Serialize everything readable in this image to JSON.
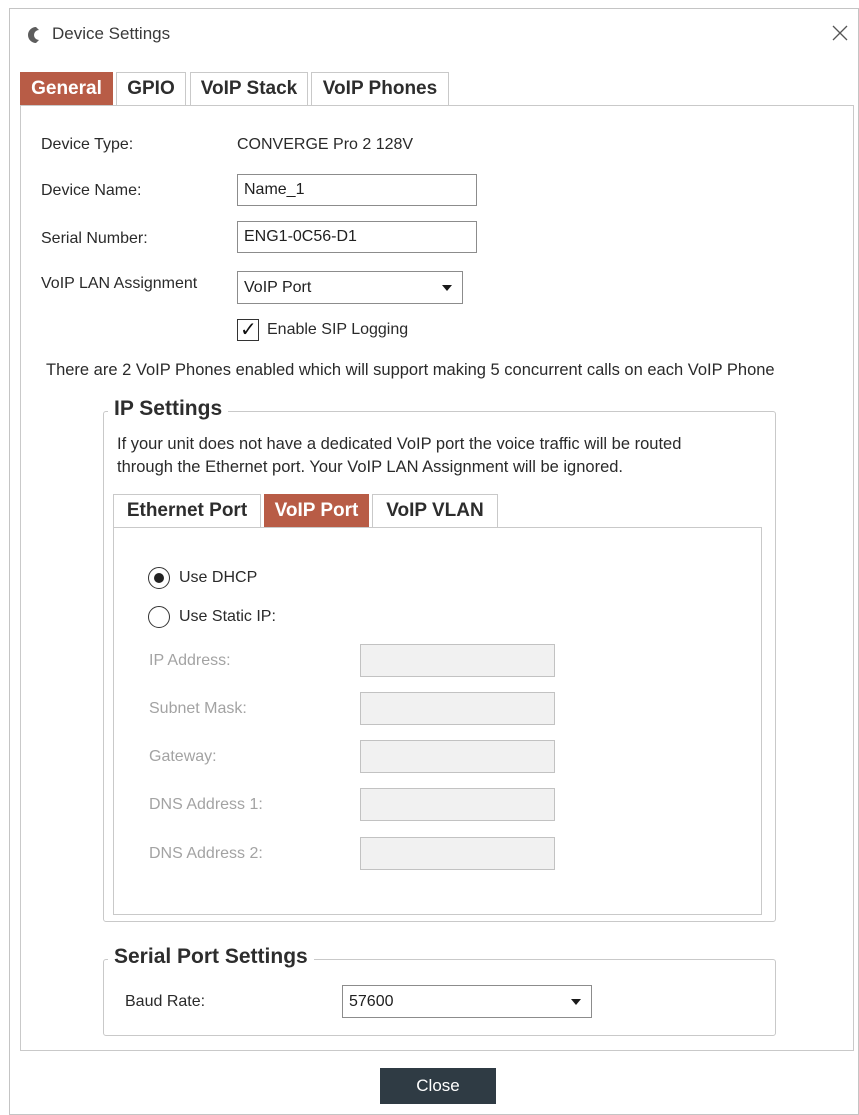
{
  "window": {
    "title": "Device Settings"
  },
  "tabs": [
    "General",
    "GPIO",
    "VoIP Stack",
    "VoIP Phones"
  ],
  "general": {
    "device_type_label": "Device Type:",
    "device_type_value": "CONVERGE Pro 2 128V",
    "device_name_label": "Device Name:",
    "device_name_value": "Name_1",
    "serial_label": "Serial Number:",
    "serial_value": "ENG1-0C56-D1",
    "voip_lan_label": "VoIP LAN Assignment",
    "voip_lan_value": "VoIP Port",
    "sip_logging_label": "Enable SIP Logging",
    "sip_logging_checked": true,
    "info_text": "There are 2 VoIP Phones enabled which will support making 5 concurrent calls on each VoIP Phone"
  },
  "ip_settings": {
    "title": "IP Settings",
    "description_line1": "If your unit does not have a dedicated VoIP port the voice traffic will be routed",
    "description_line2": "through the Ethernet port.  Your VoIP LAN Assignment will be ignored.",
    "tabs": [
      "Ethernet Port",
      "VoIP Port",
      "VoIP VLAN"
    ],
    "dhcp_label": "Use DHCP",
    "static_label": "Use Static IP:",
    "mode": "dhcp",
    "ip_label": "IP Address:",
    "subnet_label": "Subnet Mask:",
    "gateway_label": "Gateway:",
    "dns1_label": "DNS Address 1:",
    "dns2_label": "DNS Address 2:"
  },
  "serial_port": {
    "title": "Serial Port Settings",
    "baud_label": "Baud Rate:",
    "baud_value": "57600"
  },
  "footer": {
    "close_label": "Close"
  }
}
